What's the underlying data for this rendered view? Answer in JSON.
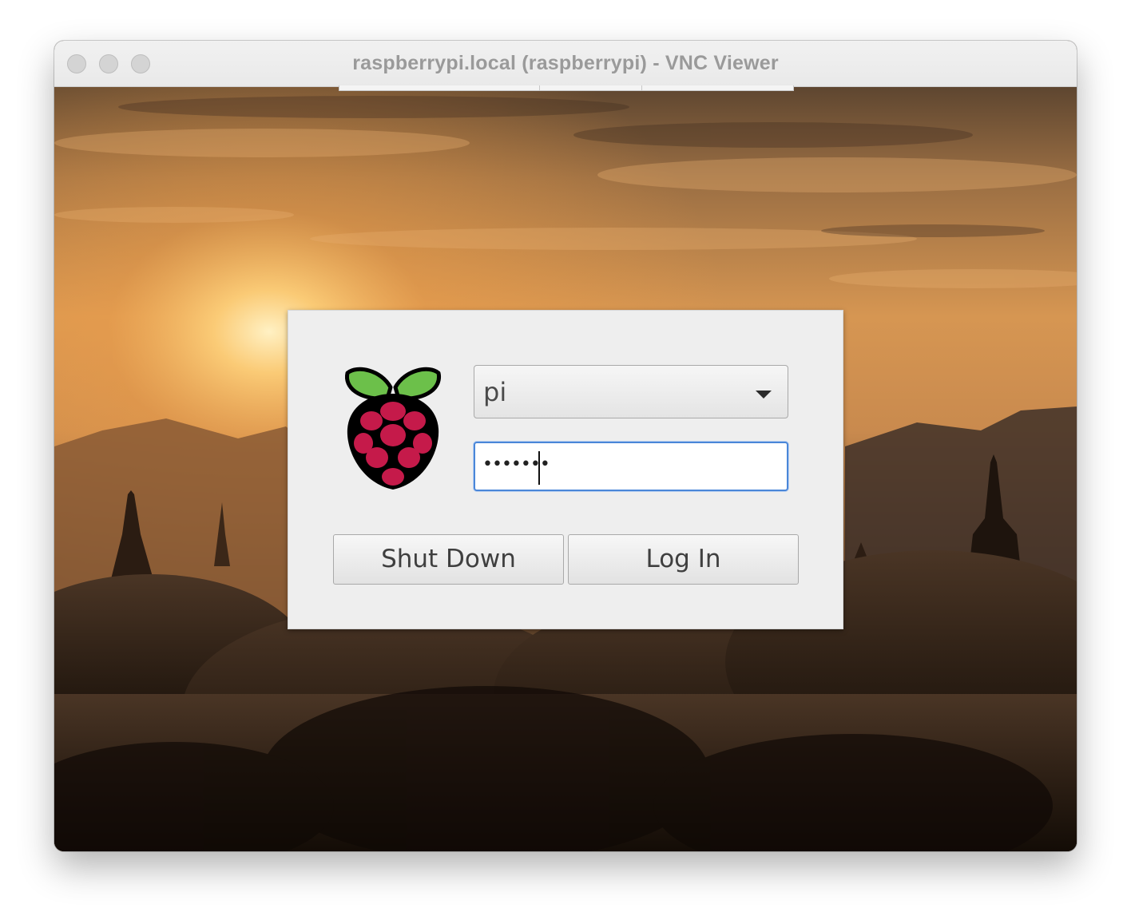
{
  "window": {
    "title": "raspberrypi.local (raspberrypi) - VNC Viewer"
  },
  "login_dialog": {
    "username": {
      "selected_value": "pi"
    },
    "password": {
      "masked_value": "•••••••"
    },
    "buttons": {
      "shutdown_label": "Shut Down",
      "login_label": "Log In"
    }
  },
  "colors": {
    "focus_ring": "#4a86d8",
    "raspberry_red": "#c51a4a",
    "leaf_green": "#6cc04a"
  },
  "icons": [
    "raspberry-pi-logo-icon",
    "dropdown-arrow-icon"
  ]
}
